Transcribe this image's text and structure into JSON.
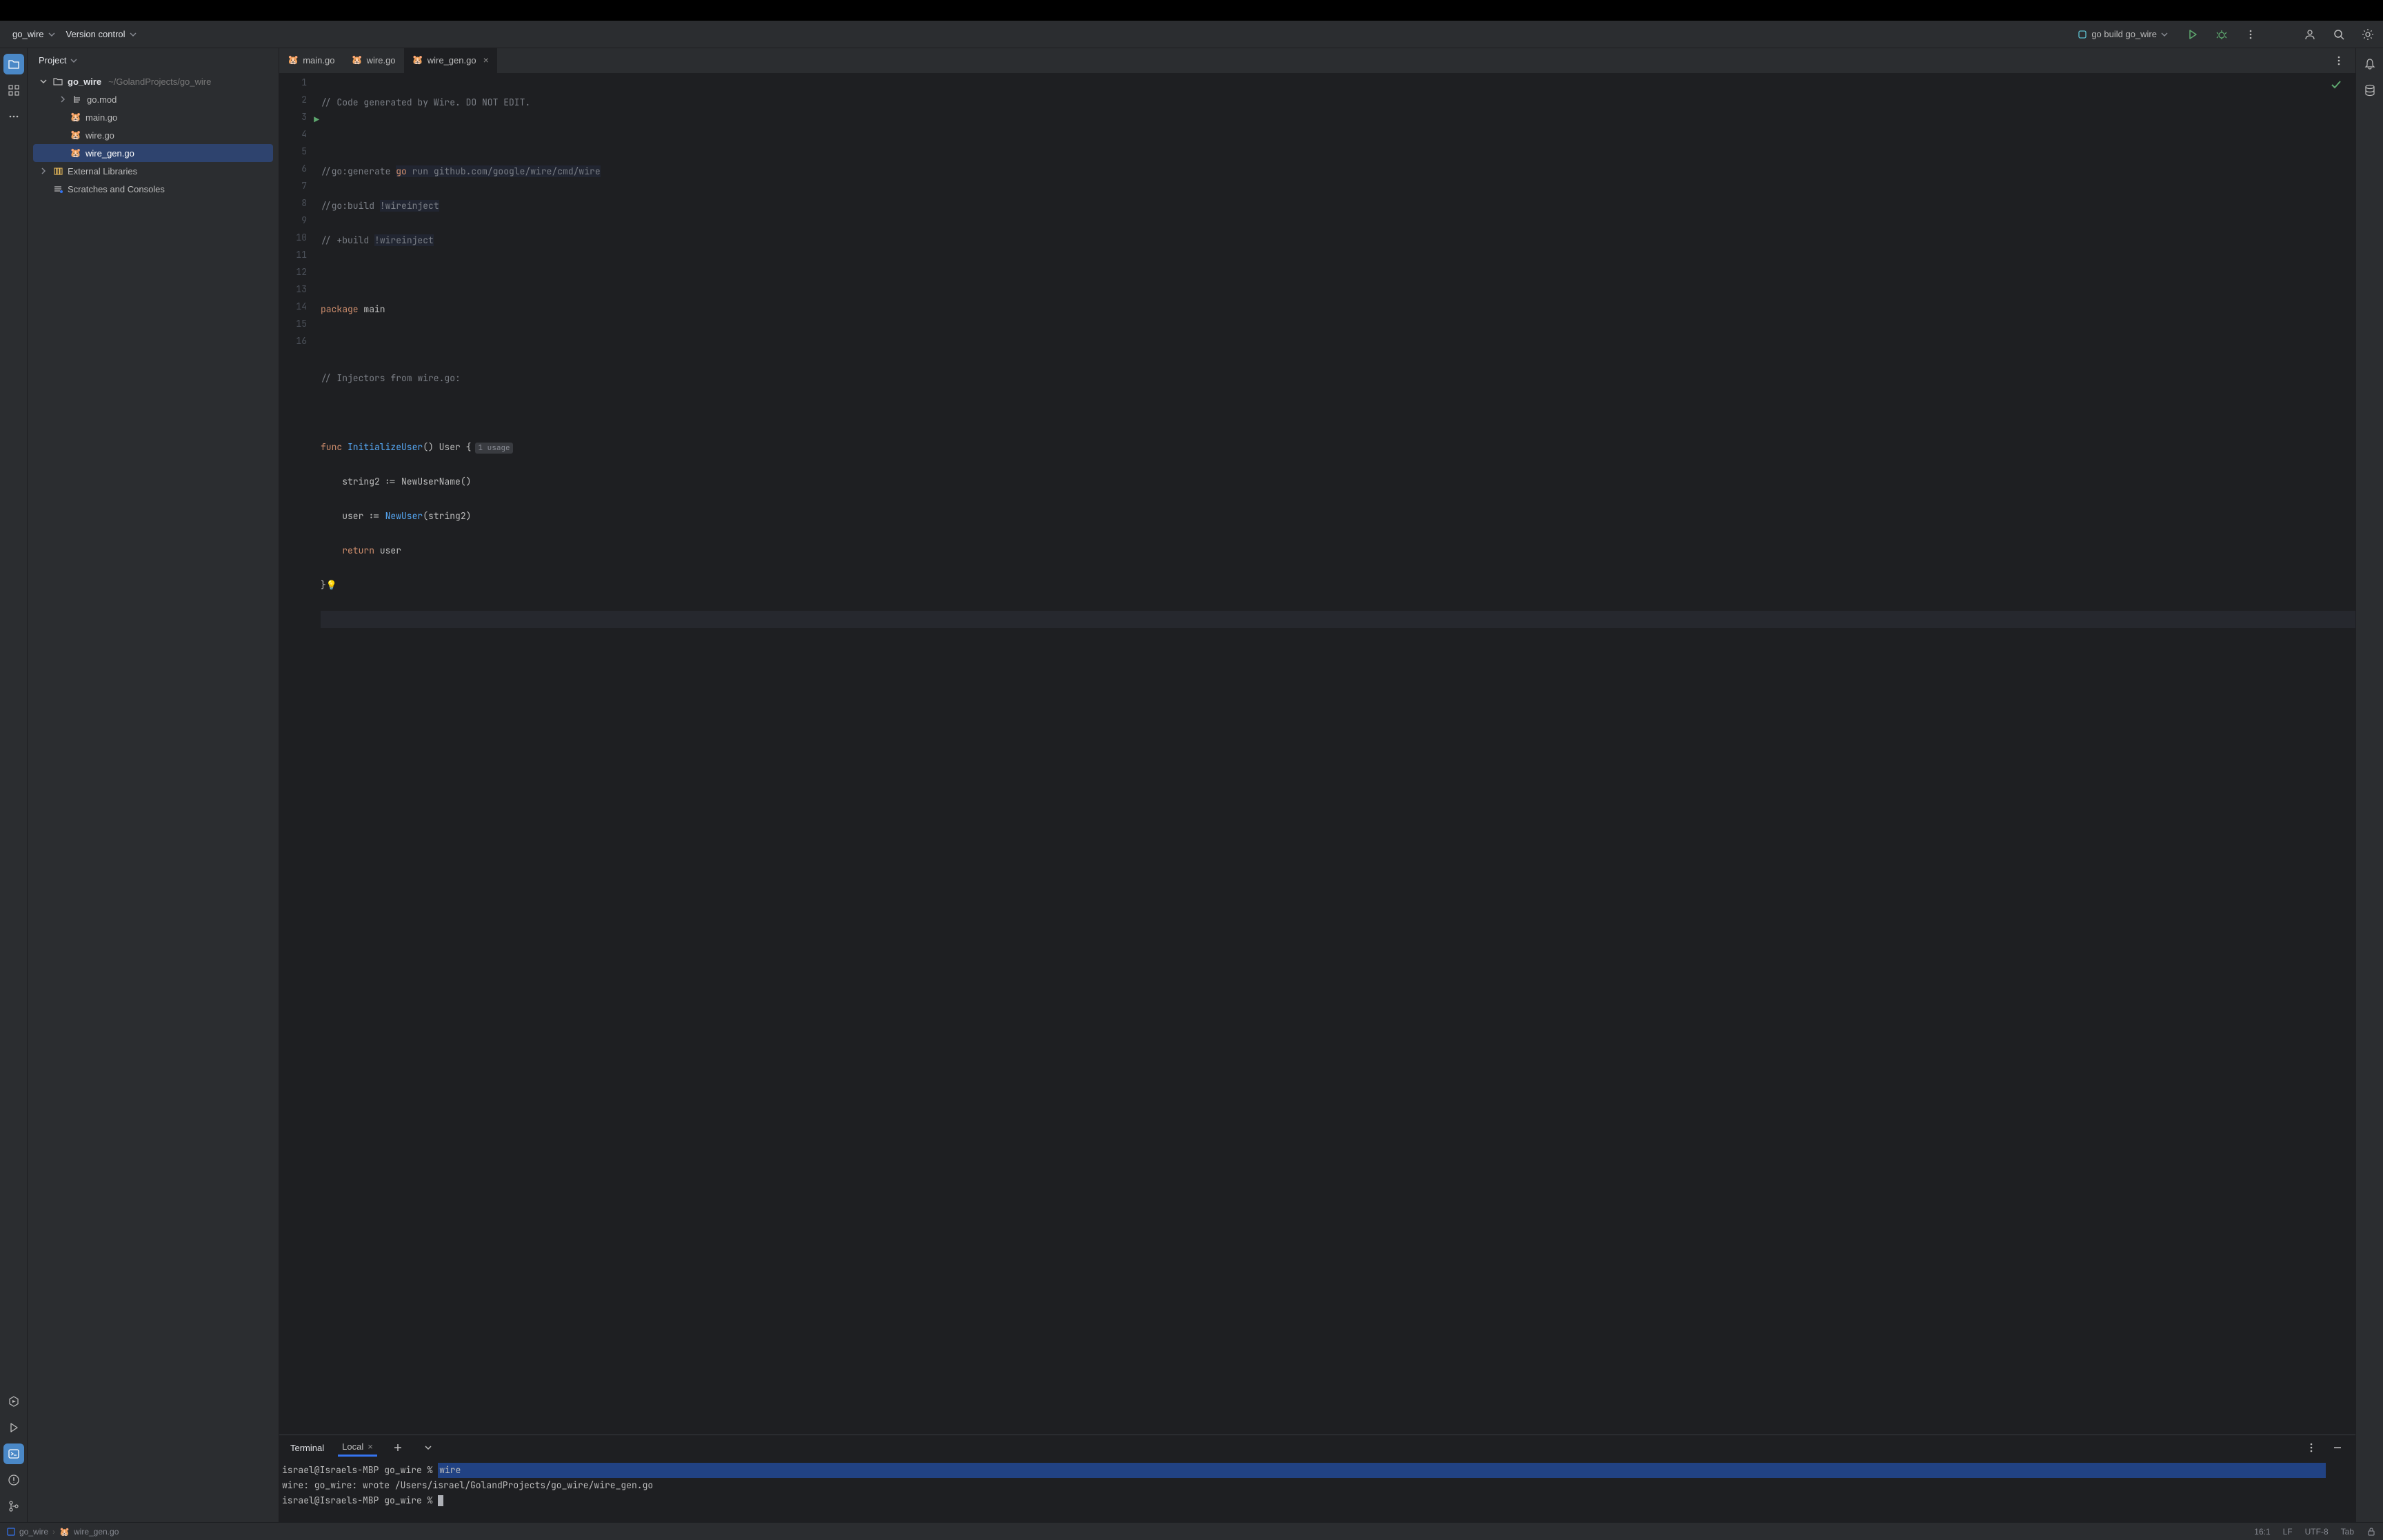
{
  "toolbar": {
    "project_name": "go_wire",
    "vcs_label": "Version control",
    "run_config": "go build go_wire"
  },
  "project_panel": {
    "title": "Project",
    "root": "go_wire",
    "root_path": "~/GolandProjects/go_wire",
    "files": {
      "go_mod": "go.mod",
      "main_go": "main.go",
      "wire_go": "wire.go",
      "wire_gen_go": "wire_gen.go"
    },
    "external_libs": "External Libraries",
    "scratches": "Scratches and Consoles"
  },
  "tabs": {
    "t0": "main.go",
    "t1": "wire.go",
    "t2": "wire_gen.go"
  },
  "code": {
    "l1a": "// Code generated by Wire. DO NOT EDIT.",
    "l3a": "//go:generate ",
    "l3b": "go",
    "l3c": " run github.com/google/wire/cmd/wire",
    "l4a": "//go:build ",
    "l4b": "!wireinject",
    "l5a": "// +build ",
    "l5b": "!wireinject",
    "l7a": "package",
    "l7b": " main",
    "l9a": "// Injectors from wire.go:",
    "l11a": "func",
    "l11b": " InitializeUser",
    "l11c": "() ",
    "l11d": "User",
    "l11e": " {",
    "l11hint": "1 usage",
    "l12": "    string2 := NewUserName()",
    "l13a": "    user := ",
    "l13b": "NewUser",
    "l13c": "(string2)",
    "l14a": "    return",
    "l14b": " user",
    "l15": "}"
  },
  "terminal": {
    "tab": "Terminal",
    "subtab": "Local",
    "prompt1": "israel@Israels-MBP go_wire % ",
    "cmd1": "wire",
    "line2": "wire: go_wire: wrote /Users/israel/GolandProjects/go_wire/wire_gen.go",
    "prompt2": "israel@Israels-MBP go_wire % "
  },
  "statusbar": {
    "bc_project": "go_wire",
    "bc_file": "wire_gen.go",
    "position": "16:1",
    "line_sep": "LF",
    "encoding": "UTF-8",
    "indent": "Tab"
  }
}
